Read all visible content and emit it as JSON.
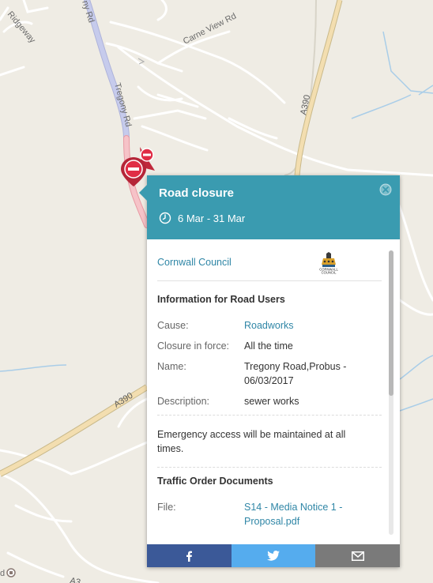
{
  "map": {
    "roads": {
      "tregony": "Tregony Rd",
      "tregony_top": "ny Rd",
      "carne_view": "Carne View Rd",
      "ridgeway": "Ridgeway",
      "a390_east": "A390",
      "a390_south": "A390",
      "a390_bottom": "A3"
    },
    "markers": [
      {
        "name": "road-closure-marker",
        "icon": "no-entry-icon"
      },
      {
        "name": "road-closure-marker-small",
        "icon": "no-entry-icon"
      }
    ],
    "bottom_left_label": "d"
  },
  "popup": {
    "title": "Road closure",
    "date_range": "6 Mar - 31 Mar",
    "header_color": "#3a9bb0",
    "council": {
      "name": "Cornwall Council",
      "logo_text": "CORNWALL COUNCIL"
    },
    "info_section": {
      "title": "Information for Road Users",
      "rows": [
        {
          "label": "Cause:",
          "value": "Roadworks"
        },
        {
          "label": "Closure in force:",
          "value": "All the time"
        },
        {
          "label": "Name:",
          "value": "Tregony Road,Probus - 06/03/2017"
        },
        {
          "label": "Description:",
          "value": "sewer works"
        }
      ]
    },
    "note": "Emergency access will be maintained at all times.",
    "documents_section": {
      "title": "Traffic Order Documents",
      "file_label": "File:",
      "file_name": "S14 - Media Notice 1 - Proposal.pdf"
    },
    "share": {
      "facebook": "facebook-icon",
      "twitter": "twitter-icon",
      "email": "email-icon",
      "colors": {
        "facebook": "#3b5998",
        "twitter": "#55acee",
        "email": "#7a7a7a"
      }
    }
  }
}
